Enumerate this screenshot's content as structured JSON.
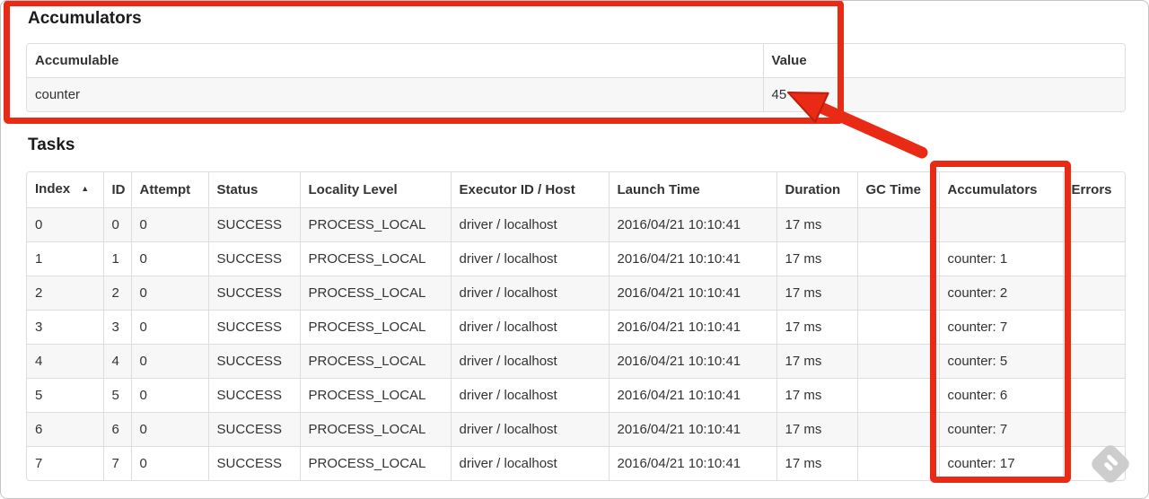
{
  "accumulators_section": {
    "heading": "Accumulators",
    "table": {
      "headers": [
        {
          "key": "accumulable",
          "label": "Accumulable"
        },
        {
          "key": "value",
          "label": "Value"
        }
      ],
      "rows": [
        {
          "accumulable": "counter",
          "value": "45"
        }
      ]
    }
  },
  "tasks_section": {
    "heading": "Tasks",
    "table": {
      "sort_icon": "▲",
      "columns": [
        {
          "key": "index",
          "label": "Index",
          "sorted": "asc"
        },
        {
          "key": "id",
          "label": "ID"
        },
        {
          "key": "attempt",
          "label": "Attempt"
        },
        {
          "key": "status",
          "label": "Status"
        },
        {
          "key": "locality_level",
          "label": "Locality Level"
        },
        {
          "key": "executor_id_host",
          "label": "Executor ID / Host"
        },
        {
          "key": "launch_time",
          "label": "Launch Time"
        },
        {
          "key": "duration",
          "label": "Duration"
        },
        {
          "key": "gc_time",
          "label": "GC Time"
        },
        {
          "key": "accumulators",
          "label": "Accumulators"
        },
        {
          "key": "errors",
          "label": "Errors"
        }
      ],
      "rows": [
        {
          "index": "0",
          "id": "0",
          "attempt": "0",
          "status": "SUCCESS",
          "locality_level": "PROCESS_LOCAL",
          "executor_id_host": "driver / localhost",
          "launch_time": "2016/04/21 10:10:41",
          "duration": "17 ms",
          "gc_time": "",
          "accumulators": "",
          "errors": ""
        },
        {
          "index": "1",
          "id": "1",
          "attempt": "0",
          "status": "SUCCESS",
          "locality_level": "PROCESS_LOCAL",
          "executor_id_host": "driver / localhost",
          "launch_time": "2016/04/21 10:10:41",
          "duration": "17 ms",
          "gc_time": "",
          "accumulators": "counter: 1",
          "errors": ""
        },
        {
          "index": "2",
          "id": "2",
          "attempt": "0",
          "status": "SUCCESS",
          "locality_level": "PROCESS_LOCAL",
          "executor_id_host": "driver / localhost",
          "launch_time": "2016/04/21 10:10:41",
          "duration": "17 ms",
          "gc_time": "",
          "accumulators": "counter: 2",
          "errors": ""
        },
        {
          "index": "3",
          "id": "3",
          "attempt": "0",
          "status": "SUCCESS",
          "locality_level": "PROCESS_LOCAL",
          "executor_id_host": "driver / localhost",
          "launch_time": "2016/04/21 10:10:41",
          "duration": "17 ms",
          "gc_time": "",
          "accumulators": "counter: 7",
          "errors": ""
        },
        {
          "index": "4",
          "id": "4",
          "attempt": "0",
          "status": "SUCCESS",
          "locality_level": "PROCESS_LOCAL",
          "executor_id_host": "driver / localhost",
          "launch_time": "2016/04/21 10:10:41",
          "duration": "17 ms",
          "gc_time": "",
          "accumulators": "counter: 5",
          "errors": ""
        },
        {
          "index": "5",
          "id": "5",
          "attempt": "0",
          "status": "SUCCESS",
          "locality_level": "PROCESS_LOCAL",
          "executor_id_host": "driver / localhost",
          "launch_time": "2016/04/21 10:10:41",
          "duration": "17 ms",
          "gc_time": "",
          "accumulators": "counter: 6",
          "errors": ""
        },
        {
          "index": "6",
          "id": "6",
          "attempt": "0",
          "status": "SUCCESS",
          "locality_level": "PROCESS_LOCAL",
          "executor_id_host": "driver / localhost",
          "launch_time": "2016/04/21 10:10:41",
          "duration": "17 ms",
          "gc_time": "",
          "accumulators": "counter: 7",
          "errors": ""
        },
        {
          "index": "7",
          "id": "7",
          "attempt": "0",
          "status": "SUCCESS",
          "locality_level": "PROCESS_LOCAL",
          "executor_id_host": "driver / localhost",
          "launch_time": "2016/04/21 10:10:41",
          "duration": "17 ms",
          "gc_time": "",
          "accumulators": "counter: 17",
          "errors": ""
        }
      ]
    }
  },
  "annotations": {
    "red": "#e92b16",
    "red_dark": "#bf1d0c",
    "watermark_gray": "#c9c9c9",
    "watermark_white": "#ffffff"
  }
}
